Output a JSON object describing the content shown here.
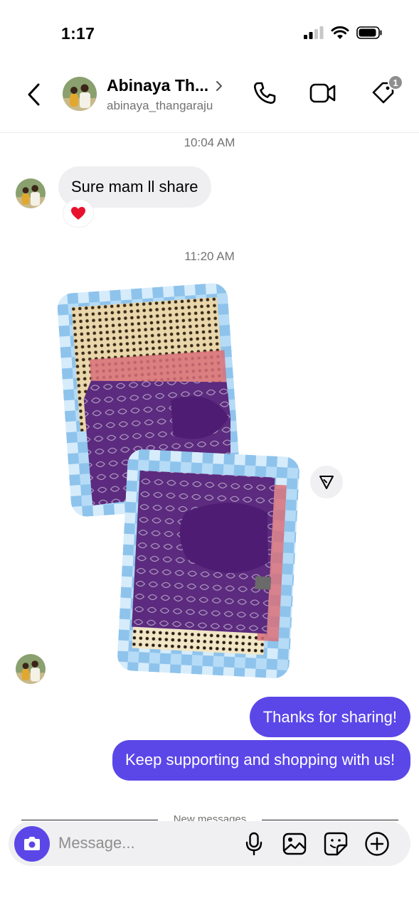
{
  "status_bar": {
    "time": "1:17",
    "icons": [
      "signal-icon",
      "wifi-icon",
      "battery-icon"
    ]
  },
  "header": {
    "name": "Abinaya Th...",
    "username": "abinaya_thangaraju",
    "tag_badge_count": "1",
    "icons": [
      "back-icon",
      "chevron-right-icon",
      "phone-icon",
      "video-icon",
      "tag-icon"
    ]
  },
  "thread": {
    "timestamp_1": "10:04 AM",
    "incoming_text": "Sure mam ll share",
    "reaction": "❤️",
    "timestamp_2": "11:20 AM",
    "outgoing_1": "Thanks for sharing!",
    "outgoing_2": "Keep supporting and shopping with us!",
    "new_messages_label": "New messages"
  },
  "composer": {
    "placeholder": "Message...",
    "icons": [
      "camera-icon",
      "microphone-icon",
      "gallery-icon",
      "sticker-icon",
      "plus-icon"
    ]
  },
  "colors": {
    "accent": "#5b47e8",
    "incoming_bubble": "#efeff1",
    "secondary_text": "#737373"
  }
}
